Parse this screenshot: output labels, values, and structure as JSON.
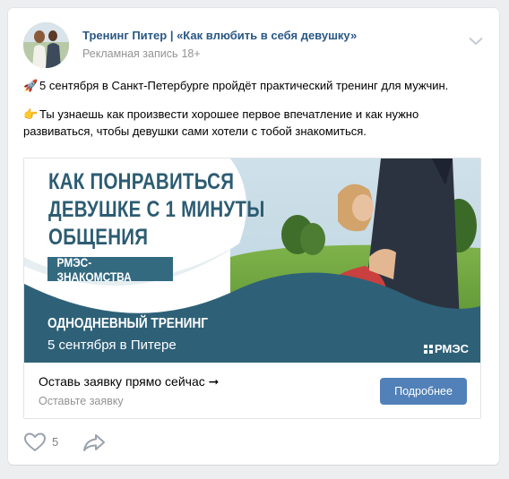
{
  "post": {
    "author": "Тренинг Питер | «Как влюбить в себя девушку»",
    "label": "Рекламная запись",
    "age_mark": "18+",
    "paragraph1": "5 сентября в Санкт-Петербурге пройдёт практический тренинг для мужчин.",
    "paragraph2": "Ты узнаешь как произвести хорошее первое впечатление и как нужно развиваться, чтобы девушки сами хотели с тобой знакомиться.",
    "emoji1": "🚀",
    "emoji2": "👉"
  },
  "banner": {
    "headline": [
      "КАК ПОНРАВИТЬСЯ",
      "ДЕВУШКЕ С 1 МИНУТЫ",
      "ОБЩЕНИЯ"
    ],
    "pill": "РМЭС-ЗНАКОМСТВА",
    "training": "ОДНОДНЕВНЫЙ ТРЕНИНГ",
    "date": "5 сентября в Питере",
    "brand": "РМЭС"
  },
  "cta": {
    "title": "Оставь заявку прямо сейчас ➞",
    "subtitle": "Оставьте заявку",
    "button": "Подробнее"
  },
  "actions": {
    "likes": "5"
  },
  "colors": {
    "link": "#2a5885",
    "button": "#5181b8",
    "banner_teal": "#2d5c72",
    "muted": "#939393"
  }
}
